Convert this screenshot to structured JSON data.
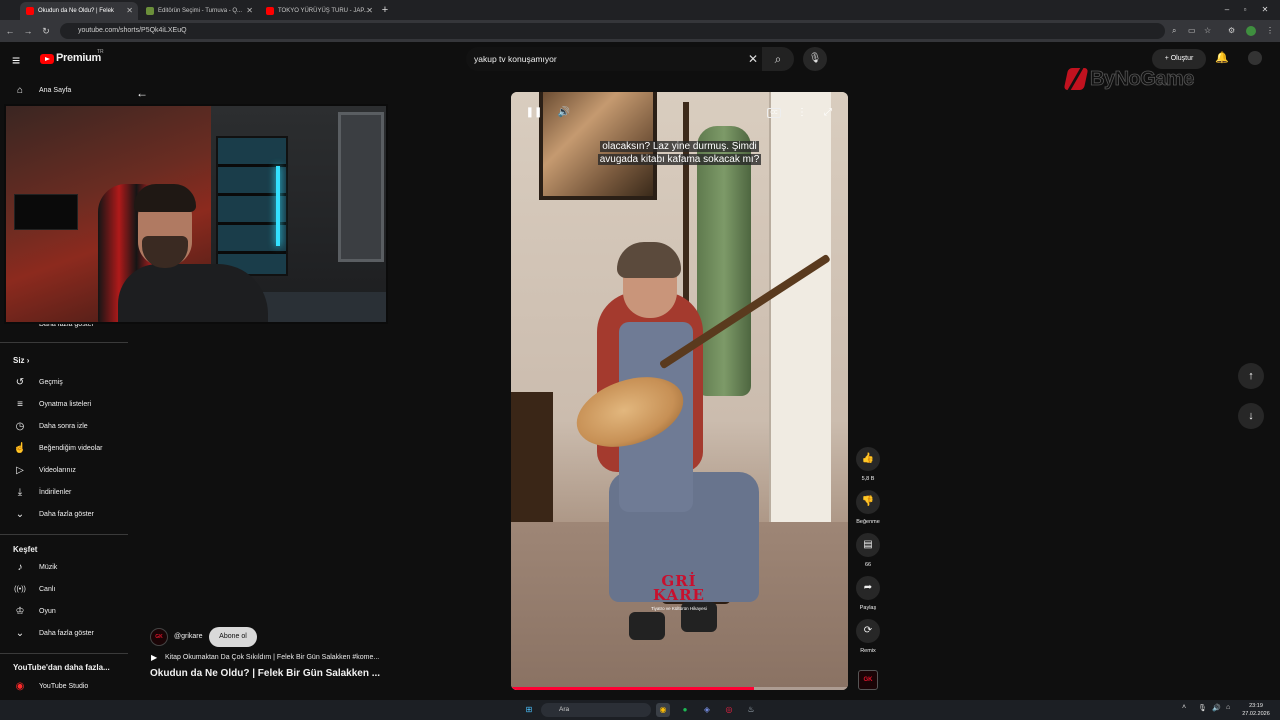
{
  "browser": {
    "tabs": [
      {
        "title": "Okudun da Ne Oldu? | Felek",
        "favicon_color": "#ff0000",
        "active": true
      },
      {
        "title": "Editörün Seçimi - Turnuva - Q...",
        "favicon_color": "#6b8f3a",
        "active": false
      },
      {
        "title": "TOKYO YÜRÜYÜŞ TURU - JAP...",
        "favicon_color": "#ff0000",
        "active": false
      }
    ],
    "new_tab": "+",
    "url": "youtube.com/shorts/P5Qk4iLXEuQ"
  },
  "header": {
    "logo_text": "Premium",
    "region": "TR",
    "search_query": "yakup tv konuşamıyor",
    "create_label": "Oluştur"
  },
  "watermark": "ByNoGame",
  "sidebar": {
    "home_label": "Ana Sayfa",
    "show_more_top": "Daha fazla göster",
    "you_heading": "Siz",
    "you_items": [
      {
        "icon": "history-icon",
        "glyph": "↺",
        "label": "Geçmiş"
      },
      {
        "icon": "playlists-icon",
        "glyph": "≡",
        "label": "Oynatma listeleri"
      },
      {
        "icon": "watch-later-icon",
        "glyph": "◷",
        "label": "Daha sonra izle"
      },
      {
        "icon": "liked-videos-icon",
        "glyph": "👍",
        "label": "Beğendiğim videolar"
      },
      {
        "icon": "your-videos-icon",
        "glyph": "▷",
        "label": "Videolarınız"
      },
      {
        "icon": "downloads-icon",
        "glyph": "⤓",
        "label": "İndirilenler"
      },
      {
        "icon": "chevron-down-icon",
        "glyph": "⌄",
        "label": "Daha fazla göster"
      }
    ],
    "explore_heading": "Keşfet",
    "explore_items": [
      {
        "icon": "music-icon",
        "glyph": "♪",
        "label": "Müzik"
      },
      {
        "icon": "live-icon",
        "glyph": "((•))",
        "label": "Canlı"
      },
      {
        "icon": "gaming-icon",
        "glyph": "🎮",
        "label": "Oyun"
      },
      {
        "icon": "chevron-down-icon",
        "glyph": "⌄",
        "label": "Daha fazla göster"
      }
    ],
    "more_heading": "YouTube'dan daha fazla...",
    "studio_label": "YouTube Studio"
  },
  "short": {
    "subtitle_line1": "olacaksın? Laz yine durmuş. Şimdi",
    "subtitle_line2": "avugada kitabı kafama sokacak mı?",
    "cc_label": "CC",
    "overlay_brand_line1": "GRİ",
    "overlay_brand_line2": "KARE",
    "overlay_brand_sub": "Tiyatro ve Kültürün Hikayesi",
    "progress_fraction": 0.72
  },
  "actions": {
    "like_count": "5,8 B",
    "dislike_label": "Beğenme",
    "comment_count": "66",
    "share_label": "Paylaş",
    "remix_label": "Remix"
  },
  "channel": {
    "handle": "@grikare",
    "subscribe_label": "Abone ol",
    "related_video": "Kitap Okumaktan Da Çok Sıkıldım | Felek Bir Gün Salakken #kome...",
    "video_title": "Okudun da Ne Oldu? | Felek Bir Gün Salakken ..."
  },
  "taskbar": {
    "search_placeholder": "Ara",
    "time": "23:19",
    "date": "27.02.2026"
  },
  "colors": {
    "accent": "#ff0000",
    "background": "#0f0f0f",
    "progress": "#ff0033"
  }
}
